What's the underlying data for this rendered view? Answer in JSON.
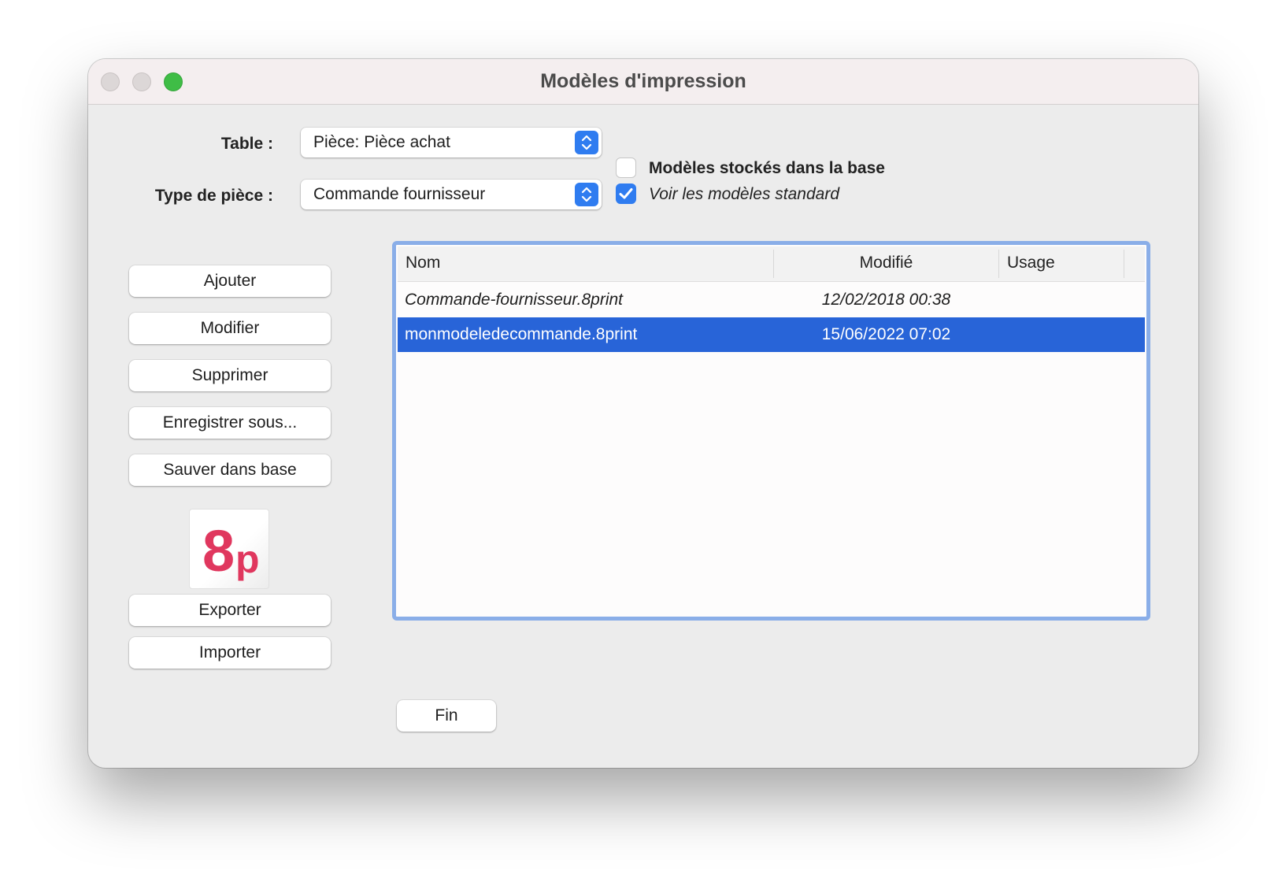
{
  "window": {
    "title": "Modèles d'impression"
  },
  "form": {
    "table_label": "Table :",
    "table_value": "Pièce: Pièce achat",
    "type_label": "Type de pièce :",
    "type_value": "Commande fournisseur",
    "checkbox_stored": {
      "label": "Modèles stockés dans la base",
      "checked": false
    },
    "checkbox_standard": {
      "label": "Voir les modèles standard",
      "checked": true
    }
  },
  "actions": {
    "add": "Ajouter",
    "modify": "Modifier",
    "delete": "Supprimer",
    "save_as": "Enregistrer sous...",
    "save_db": "Sauver dans base",
    "export": "Exporter",
    "import": "Importer",
    "finish": "Fin"
  },
  "logo": {
    "digit": "8",
    "letter": "p",
    "color": "#e0375e"
  },
  "list": {
    "columns": [
      "Nom",
      "Modifié",
      "Usage"
    ],
    "rows": [
      {
        "name": "Commande-fournisseur.8print",
        "modified": "12/02/2018 00:38",
        "usage": "",
        "selected": false,
        "italic": true
      },
      {
        "name": "monmodeledecommande.8print",
        "modified": "15/06/2022 07:02",
        "usage": "",
        "selected": true,
        "italic": false
      }
    ]
  },
  "colors": {
    "accent": "#2f7cf0",
    "selection": "#2864d8",
    "focus_ring": "#8aaee8"
  }
}
